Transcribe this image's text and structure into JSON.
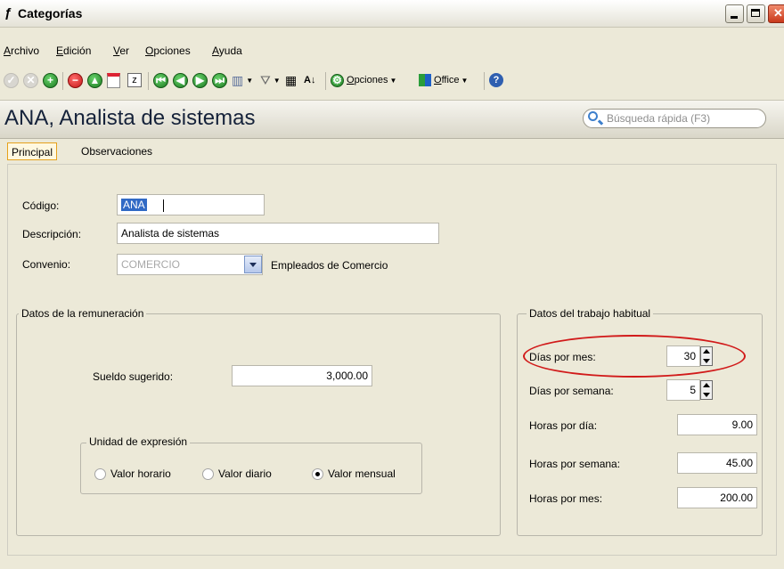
{
  "window": {
    "title": "Categorías"
  },
  "menu": [
    "Archivo",
    "Edición",
    "Ver",
    "Opciones",
    "Ayuda"
  ],
  "toolbar": {
    "opciones_label": "Opciones",
    "office_label": "Office"
  },
  "header": {
    "record_title": "ANA, Analista de sistemas",
    "search_placeholder": "Búsqueda rápida (F3)"
  },
  "tabs": [
    "Principal",
    "Observaciones"
  ],
  "form": {
    "codigo_label": "Código:",
    "codigo_value": "ANA",
    "descripcion_label": "Descripción:",
    "descripcion_value": "Analista de sistemas",
    "convenio_label": "Convenio:",
    "convenio_value": "COMERCIO",
    "convenio_desc": "Empleados de Comercio"
  },
  "remuneracion": {
    "title": "Datos de la remuneración",
    "sueldo_label": "Sueldo sugerido:",
    "sueldo_value": "3,000.00",
    "unidad_title": "Unidad de expresión",
    "options": [
      {
        "label": "Valor horario",
        "selected": false
      },
      {
        "label": "Valor diario",
        "selected": false
      },
      {
        "label": "Valor mensual",
        "selected": true
      }
    ]
  },
  "trabajo": {
    "title": "Datos del trabajo habitual",
    "dias_mes_label": "Días por mes:",
    "dias_mes_value": "30",
    "dias_semana_label": "Días por semana:",
    "dias_semana_value": "5",
    "horas_dia_label": "Horas por día:",
    "horas_dia_value": "9.00",
    "horas_semana_label": "Horas por semana:",
    "horas_semana_value": "45.00",
    "horas_mes_label": "Horas por mes:",
    "horas_mes_value": "200.00"
  },
  "colors": {
    "highlight_oval": "#d11a1a",
    "active_tab_border": "#e6a11c",
    "selection": "#316ac5"
  }
}
